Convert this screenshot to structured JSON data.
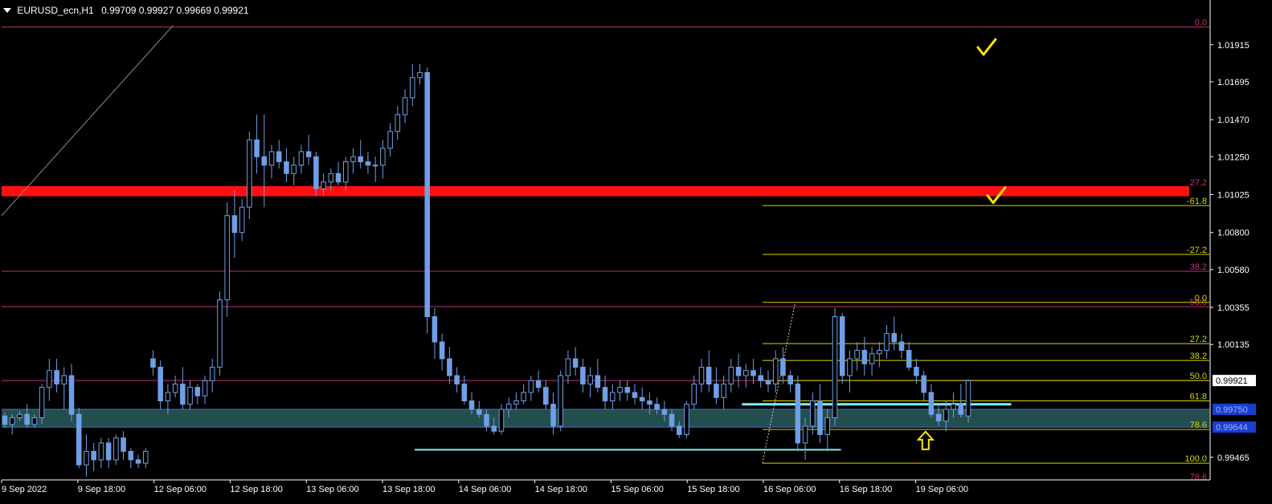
{
  "header": {
    "symbol": "EURUSD_ecn,H1",
    "ohlc": "0.99709 0.99927 0.99669 0.99921"
  },
  "chart_data": {
    "type": "candlestick",
    "background": "#000000",
    "candle_color": "#6f9fe6",
    "y_range": [
      0.9934,
      1.02095
    ],
    "price_ticks": [
      "1.01915",
      "1.01695",
      "1.01470",
      "1.01250",
      "1.01025",
      "1.00800",
      "1.00580",
      "1.00355",
      "1.00135",
      "0.99465"
    ],
    "time_ticks": [
      "9 Sep 2022",
      "9 Sep 18:00",
      "12 Sep 06:00",
      "12 Sep 18:00",
      "13 Sep 06:00",
      "13 Sep 18:00",
      "14 Sep 06:00",
      "14 Sep 18:00",
      "15 Sep 06:00",
      "15 Sep 18:00",
      "16 Sep 06:00",
      "16 Sep 18:00",
      "19 Sep 06:00"
    ],
    "current_price_label": "0.99921",
    "zone_labels": [
      "0.99750",
      "0.99644"
    ],
    "candles": [
      [
        0.9971,
        0.9973,
        0.9964,
        0.9966
      ],
      [
        0.9966,
        0.9972,
        0.996,
        0.997
      ],
      [
        0.997,
        0.9974,
        0.9968,
        0.9972
      ],
      [
        0.9972,
        0.9978,
        0.9964,
        0.9966
      ],
      [
        0.9966,
        0.9972,
        0.9964,
        0.997
      ],
      [
        0.997,
        0.999,
        0.9966,
        0.9988
      ],
      [
        0.9988,
        1.0005,
        0.998,
        0.9998
      ],
      [
        0.9998,
        1.0005,
        0.9985,
        0.999
      ],
      [
        0.999,
        1.0,
        0.9975,
        0.9995
      ],
      [
        0.9995,
        1.0002,
        0.9968,
        0.9972
      ],
      [
        0.9972,
        0.9976,
        0.994,
        0.9942
      ],
      [
        0.9942,
        0.996,
        0.9935,
        0.995
      ],
      [
        0.995,
        0.9955,
        0.9938,
        0.9945
      ],
      [
        0.9945,
        0.9958,
        0.994,
        0.9955
      ],
      [
        0.9955,
        0.9958,
        0.994,
        0.9945
      ],
      [
        0.9945,
        0.996,
        0.9942,
        0.9958
      ],
      [
        0.9958,
        0.9962,
        0.9945,
        0.995
      ],
      [
        0.995,
        0.9952,
        0.994,
        0.9945
      ],
      [
        0.9945,
        0.9948,
        0.994,
        0.9943
      ],
      [
        0.9943,
        0.9952,
        0.994,
        0.995
      ],
      [
        1.0005,
        1.001,
        0.9995,
        1.0
      ],
      [
        1.0,
        1.0004,
        0.9975,
        0.998
      ],
      [
        0.998,
        0.999,
        0.9972,
        0.9985
      ],
      [
        0.9985,
        0.9995,
        0.9982,
        0.999
      ],
      [
        0.999,
        1.0,
        0.9975,
        0.9978
      ],
      [
        0.9978,
        0.9992,
        0.9975,
        0.9988
      ],
      [
        0.9988,
        0.999,
        0.9978,
        0.9983
      ],
      [
        0.9983,
        0.9995,
        0.9978,
        0.9992
      ],
      [
        0.9992,
        1.0005,
        0.9985,
        1.0
      ],
      [
        1.0,
        1.0045,
        0.9995,
        1.004
      ],
      [
        1.004,
        1.0098,
        1.003,
        1.009
      ],
      [
        1.009,
        1.0105,
        1.0065,
        1.008
      ],
      [
        1.008,
        1.01,
        1.0075,
        1.0095
      ],
      [
        1.0095,
        1.014,
        1.0088,
        1.0135
      ],
      [
        1.0135,
        1.015,
        1.0115,
        1.0125
      ],
      [
        1.0125,
        1.015,
        1.0095,
        1.012
      ],
      [
        1.012,
        1.0132,
        1.0112,
        1.0128
      ],
      [
        1.0128,
        1.0135,
        1.0118,
        1.0122
      ],
      [
        1.0122,
        1.013,
        1.011,
        1.0115
      ],
      [
        1.0115,
        1.0125,
        1.0108,
        1.012
      ],
      [
        1.012,
        1.0132,
        1.0115,
        1.0128
      ],
      [
        1.0128,
        1.0138,
        1.012,
        1.0125
      ],
      [
        1.0125,
        1.0128,
        1.0102,
        1.0106
      ],
      [
        1.0106,
        1.0115,
        1.0102,
        1.011
      ],
      [
        1.011,
        1.0118,
        1.0105,
        1.0115
      ],
      [
        1.0115,
        1.0122,
        1.0108,
        1.011
      ],
      [
        1.011,
        1.0125,
        1.0105,
        1.0122
      ],
      [
        1.0122,
        1.013,
        1.0115,
        1.0125
      ],
      [
        1.0125,
        1.0135,
        1.0118,
        1.0122
      ],
      [
        1.0122,
        1.0128,
        1.0115,
        1.012
      ],
      [
        1.012,
        1.0125,
        1.011,
        1.012
      ],
      [
        1.012,
        1.0135,
        1.0112,
        1.013
      ],
      [
        1.013,
        1.0145,
        1.0125,
        1.014
      ],
      [
        1.014,
        1.0155,
        1.0135,
        1.015
      ],
      [
        1.015,
        1.0165,
        1.0145,
        1.016
      ],
      [
        1.016,
        1.018,
        1.0155,
        1.0172
      ],
      [
        1.0172,
        1.018,
        1.0168,
        1.0175
      ],
      [
        1.0175,
        1.0178,
        1.002,
        1.003
      ],
      [
        1.003,
        1.0035,
        1.0005,
        1.0015
      ],
      [
        1.0015,
        1.002,
        0.9998,
        1.0005
      ],
      [
        1.0005,
        1.0012,
        0.999,
        0.9995
      ],
      [
        0.9995,
        1.0,
        0.9985,
        0.999
      ],
      [
        0.999,
        0.9995,
        0.9978,
        0.998
      ],
      [
        0.998,
        0.9985,
        0.9972,
        0.9975
      ],
      [
        0.9975,
        0.998,
        0.997,
        0.9972
      ],
      [
        0.9972,
        0.9975,
        0.9962,
        0.9965
      ],
      [
        0.9965,
        0.997,
        0.996,
        0.9962
      ],
      [
        0.9962,
        0.9978,
        0.996,
        0.9975
      ],
      [
        0.9975,
        0.9982,
        0.997,
        0.9978
      ],
      [
        0.9978,
        0.9985,
        0.9975,
        0.998
      ],
      [
        0.998,
        0.999,
        0.9978,
        0.9985
      ],
      [
        0.9985,
        0.9995,
        0.998,
        0.9992
      ],
      [
        0.9992,
        0.9998,
        0.9985,
        0.9988
      ],
      [
        0.9988,
        0.9992,
        0.9975,
        0.9978
      ],
      [
        0.9978,
        0.9985,
        0.996,
        0.9965
      ],
      [
        0.9965,
        0.9998,
        0.9962,
        0.9995
      ],
      [
        0.9995,
        1.001,
        0.999,
        1.0005
      ],
      [
        1.0005,
        1.0012,
        0.9995,
        1.0
      ],
      [
        1.0,
        1.0005,
        0.9985,
        0.999
      ],
      [
        0.999,
        1.0,
        0.9982,
        0.9995
      ],
      [
        0.9995,
        1.0005,
        0.9985,
        0.9988
      ],
      [
        0.9988,
        0.9995,
        0.9975,
        0.998
      ],
      [
        0.998,
        0.999,
        0.9975,
        0.9985
      ],
      [
        0.9985,
        0.9992,
        0.998,
        0.9988
      ],
      [
        0.9988,
        0.9992,
        0.998,
        0.9985
      ],
      [
        0.9985,
        0.999,
        0.9978,
        0.9982
      ],
      [
        0.9982,
        0.9988,
        0.9975,
        0.998
      ],
      [
        0.998,
        0.9985,
        0.9972,
        0.9978
      ],
      [
        0.9978,
        0.9982,
        0.9972,
        0.9975
      ],
      [
        0.9975,
        0.998,
        0.9968,
        0.9972
      ],
      [
        0.9972,
        0.9975,
        0.9962,
        0.9965
      ],
      [
        0.9965,
        0.9968,
        0.9958,
        0.996
      ],
      [
        0.996,
        0.998,
        0.9958,
        0.9978
      ],
      [
        0.9978,
        0.9995,
        0.9975,
        0.999
      ],
      [
        0.999,
        1.0005,
        0.9985,
        1.0
      ],
      [
        1.0,
        1.001,
        0.9985,
        0.999
      ],
      [
        0.999,
        1.0,
        0.9978,
        0.9982
      ],
      [
        0.9982,
        0.9995,
        0.9975,
        0.999
      ],
      [
        0.999,
        1.0005,
        0.9985,
        1.0
      ],
      [
        1.0,
        1.0008,
        0.9988,
        0.9995
      ],
      [
        0.9995,
        1.0002,
        0.9988,
        0.9998
      ],
      [
        0.9998,
        1.0005,
        0.999,
        0.9995
      ],
      [
        0.9995,
        1.0,
        0.9988,
        0.9992
      ],
      [
        0.9992,
        0.9998,
        0.9985,
        0.999
      ],
      [
        0.999,
        1.001,
        0.9985,
        1.0005
      ],
      [
        1.0005,
        1.0012,
        0.999,
        0.9995
      ],
      [
        0.9995,
        0.9998,
        0.9985,
        0.999
      ],
      [
        0.999,
        0.9995,
        0.995,
        0.9955
      ],
      [
        0.9955,
        0.997,
        0.9945,
        0.9965
      ],
      [
        0.9965,
        0.9985,
        0.996,
        0.998
      ],
      [
        0.998,
        0.999,
        0.9955,
        0.996
      ],
      [
        0.996,
        0.9975,
        0.995,
        0.997
      ],
      [
        0.997,
        1.0035,
        0.9965,
        1.003
      ],
      [
        1.003,
        1.0032,
        0.999,
        0.9995
      ],
      [
        0.9995,
        1.001,
        0.9985,
        1.0005
      ],
      [
        1.0005,
        1.0015,
        0.9998,
        1.001
      ],
      [
        1.001,
        1.0018,
        0.9995,
        1.0002
      ],
      [
        1.0002,
        1.0012,
        0.9995,
        1.0008
      ],
      [
        1.0008,
        1.0015,
        1.0,
        1.001
      ],
      [
        1.001,
        1.0025,
        1.0005,
        1.002
      ],
      [
        1.002,
        1.003,
        1.001,
        1.0015
      ],
      [
        1.0015,
        1.002,
        1.0005,
        1.001
      ],
      [
        1.001,
        1.0015,
        0.9998,
        1.0
      ],
      [
        1.0,
        1.0005,
        0.999,
        0.9995
      ],
      [
        0.9995,
        0.9998,
        0.998,
        0.9985
      ],
      [
        0.9985,
        0.999,
        0.997,
        0.9972
      ],
      [
        0.9972,
        0.9978,
        0.9965,
        0.9968
      ],
      [
        0.9968,
        0.998,
        0.9962,
        0.9975
      ],
      [
        0.9975,
        0.9985,
        0.997,
        0.9978
      ],
      [
        0.9978,
        0.999,
        0.997,
        0.9972
      ],
      [
        0.9971,
        0.9993,
        0.9967,
        0.9992
      ]
    ],
    "horizontal_lines": [
      {
        "price": 1.0202,
        "color": "#c0307a",
        "label": "0.0",
        "label_color": "#c0307a"
      },
      {
        "price": 1.0057,
        "color": "#c0307a",
        "label": "38.2",
        "label_color": "#c0307a"
      },
      {
        "price": 1.0036,
        "color": "#c0307a",
        "label": "50.0",
        "label_color": "#c0307a"
      },
      {
        "price": 0.99921,
        "color": "#c0307a",
        "label": "",
        "label_color": "#c0307a"
      }
    ],
    "red_band": {
      "from": 1.01015,
      "to": 1.01075,
      "label": "27.2"
    },
    "zone": {
      "from": 0.99644,
      "to": 0.9975,
      "color": "#2a5a5a"
    },
    "fib_right": {
      "color": "#d6d600",
      "x_start_frac": 0.63,
      "levels": [
        {
          "price": 1.0096,
          "label": "-61.8"
        },
        {
          "price": 1.0067,
          "label": "-27.2"
        },
        {
          "price": 1.00385,
          "label": "0.0"
        },
        {
          "price": 1.0014,
          "label": "27.2"
        },
        {
          "price": 1.0004,
          "label": "38.2"
        },
        {
          "price": 0.99921,
          "label": "50.0"
        },
        {
          "price": 0.998,
          "label": "61.8"
        },
        {
          "price": 0.9963,
          "label": "78.6"
        },
        {
          "price": 0.9943,
          "label": "100.0"
        }
      ]
    },
    "bottom_label": {
      "text": "78.6",
      "color": "#c0307a"
    },
    "cyan_lines": [
      {
        "price": 0.9951,
        "from_frac": 0.342,
        "to_frac": 0.695
      },
      {
        "price": 0.9978,
        "from_frac": 0.613,
        "to_frac": 0.836
      }
    ],
    "annotations": [
      {
        "type": "check",
        "x_frac": 0.815,
        "price": 1.0189
      },
      {
        "type": "check",
        "x_frac": 0.823,
        "price": 1.0101
      },
      {
        "type": "up-arrow",
        "x_frac": 0.765,
        "price": 0.9956
      }
    ]
  }
}
